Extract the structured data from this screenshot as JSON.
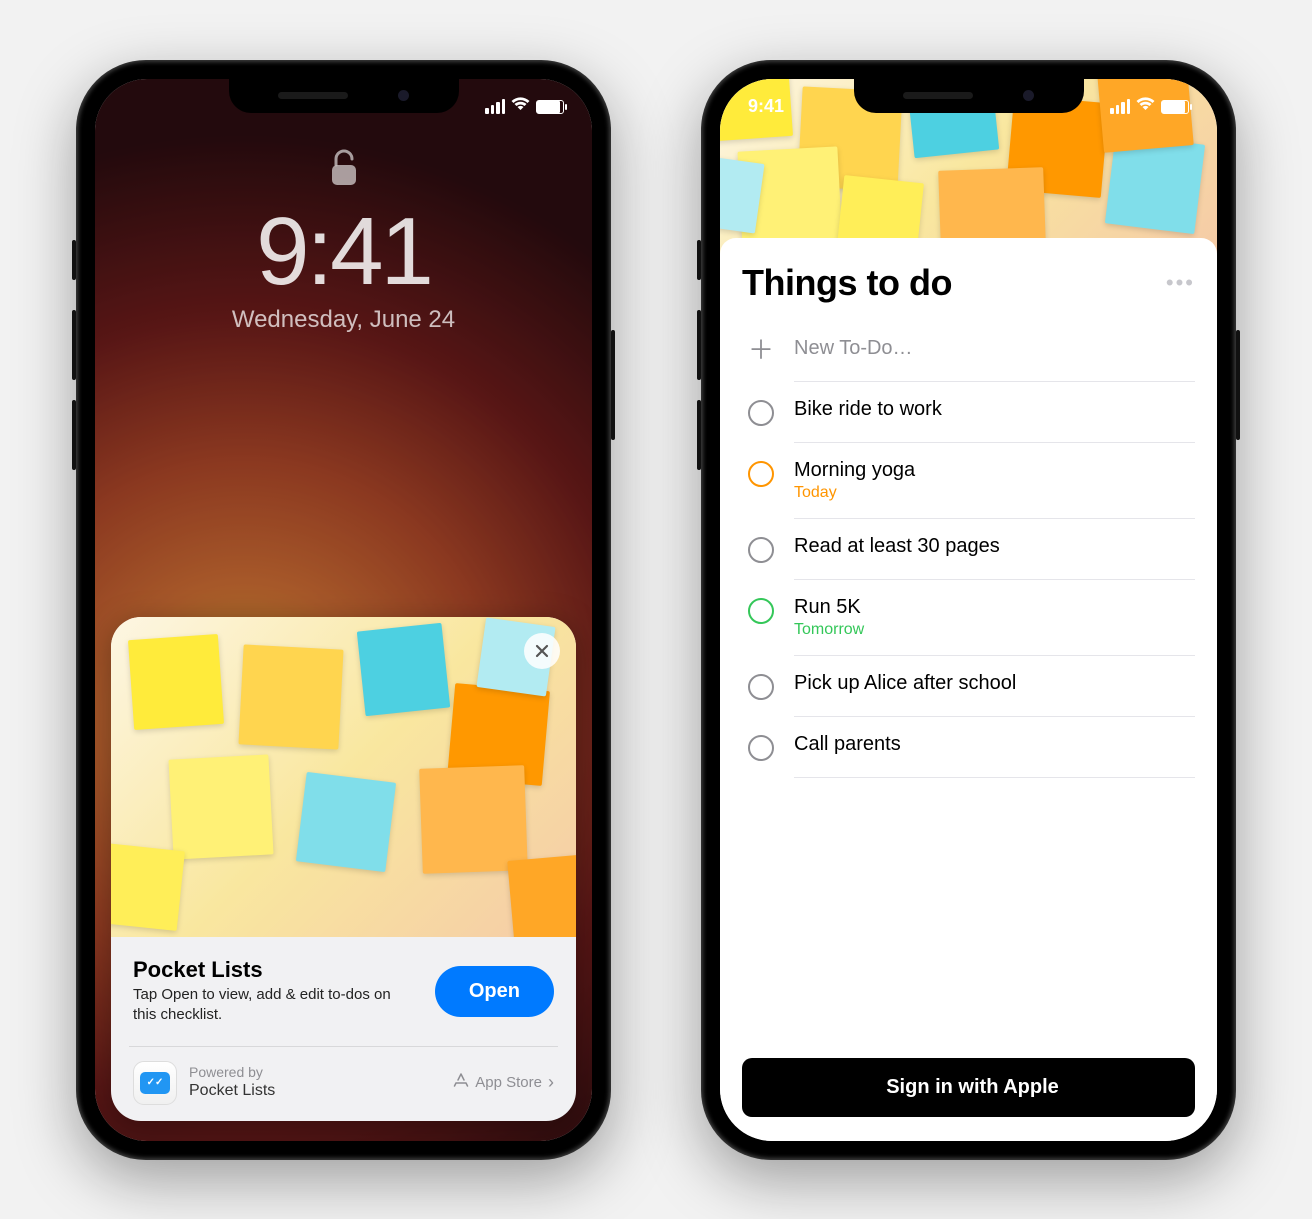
{
  "left_phone": {
    "status_time": "",
    "lock_time": "9:41",
    "lock_date": "Wednesday, June 24",
    "appclip": {
      "title": "Pocket Lists",
      "subtitle": "Tap Open to view, add & edit to-dos on this checklist.",
      "open_label": "Open",
      "powered_by": "Powered by",
      "app_name": "Pocket Lists",
      "appstore_label": "App Store"
    }
  },
  "right_phone": {
    "status_time": "9:41",
    "list_title": "Things to do",
    "new_todo_placeholder": "New To-Do…",
    "todos": [
      {
        "text": "Bike ride to work",
        "sub": "",
        "color": ""
      },
      {
        "text": "Morning yoga",
        "sub": "Today",
        "color": "orange"
      },
      {
        "text": "Read at least 30 pages",
        "sub": "",
        "color": ""
      },
      {
        "text": "Run 5K",
        "sub": "Tomorrow",
        "color": "green"
      },
      {
        "text": "Pick up Alice after school",
        "sub": "",
        "color": ""
      },
      {
        "text": "Call parents",
        "sub": "",
        "color": ""
      }
    ],
    "signin_label": "Sign in with Apple"
  }
}
